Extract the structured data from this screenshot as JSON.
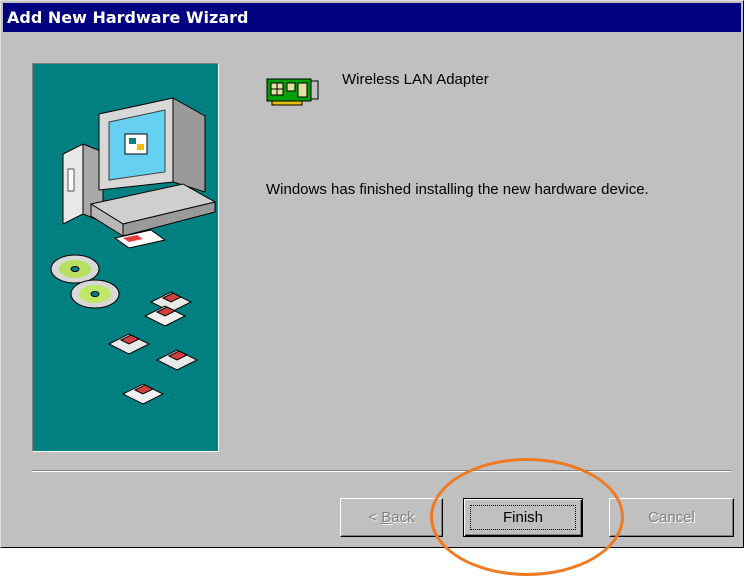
{
  "window": {
    "title": "Add New Hardware Wizard"
  },
  "device": {
    "icon": "network-adapter-card-icon",
    "name": "Wireless LAN Adapter"
  },
  "message": "Windows has finished installing the new hardware device.",
  "buttons": {
    "back": {
      "prefix": "< ",
      "accel": "B",
      "rest": "ack",
      "enabled": false
    },
    "finish": {
      "label": "Finish",
      "focused": true
    },
    "cancel": {
      "label": "Cancel",
      "enabled": false
    }
  },
  "colors": {
    "titlebar": "#000080",
    "face": "#c0c0c0",
    "art_background": "#008080",
    "highlight": "#ef7a21"
  }
}
